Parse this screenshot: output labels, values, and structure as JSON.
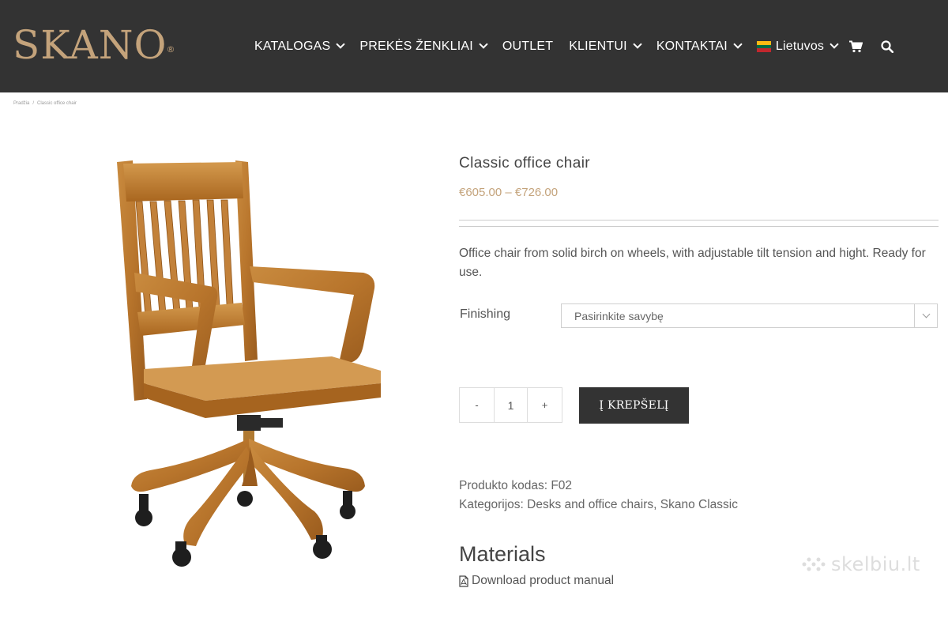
{
  "header": {
    "logo": "SKANO",
    "logo_mark": "®",
    "nav": [
      {
        "label": "KATALOGAS",
        "has_dropdown": true
      },
      {
        "label": "PREKĖS ŽENKLIAI",
        "has_dropdown": true
      },
      {
        "label": "OUTLET",
        "has_dropdown": false
      },
      {
        "label": "KLIENTUI",
        "has_dropdown": true
      },
      {
        "label": "KONTAKTAI",
        "has_dropdown": true
      }
    ],
    "language": {
      "label": "Lietuvos",
      "flag_colors": [
        "#FDB913",
        "#006A44",
        "#C1272D"
      ]
    },
    "cart_icon": "cart-icon",
    "search_icon": "search-icon"
  },
  "breadcrumb": [
    "Pradžia",
    "/",
    "Classic office chair"
  ],
  "product": {
    "title": "Classic office chair",
    "price": "€605.00 – €726.00",
    "description": "Office chair from solid birch on wheels, with adjustable tilt tension and hight. Ready for use.",
    "finishing_label": "Finishing",
    "finishing_placeholder": "Pasirinkite savybę",
    "qty_minus": "-",
    "qty_value": "1",
    "qty_plus": "+",
    "add_to_cart": "Į KREPŠELĮ",
    "sku_label": "Produkto kodas:",
    "sku_value": "F02",
    "categories_label": "Kategorijos:",
    "categories": [
      "Desks and office chairs",
      "Skano Classic"
    ],
    "materials_heading": "Materials",
    "download_label": "Download product manual"
  },
  "watermark": "skelbiu.lt",
  "colors": {
    "header_bg": "#333333",
    "accent_gold": "#c4a37b",
    "button_bg": "#333333"
  }
}
